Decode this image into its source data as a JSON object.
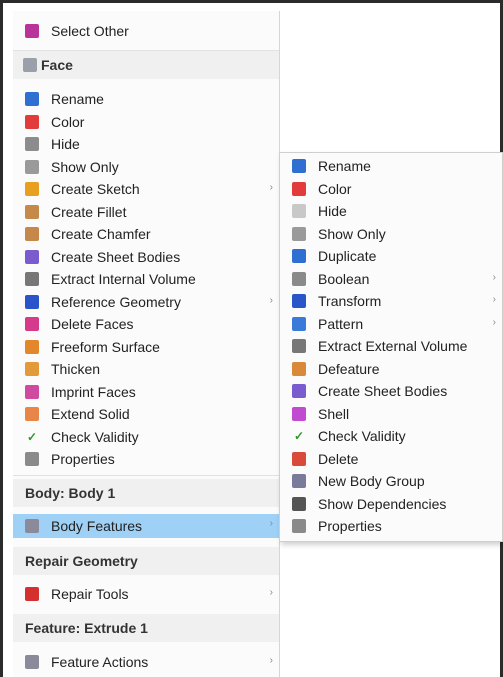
{
  "main_menu": {
    "top_item": {
      "label": "Select Other",
      "icon": "select-other-icon",
      "color": "#b8339a"
    },
    "face_header": {
      "label": "Face",
      "icon": "face-icon"
    },
    "face_items": [
      {
        "label": "Rename",
        "icon": "rename-icon",
        "color": "#2f6fd1"
      },
      {
        "label": "Color",
        "icon": "color-wheel-icon",
        "color": "#e23b3b"
      },
      {
        "label": "Hide",
        "icon": "hide-icon",
        "color": "#8c8c8c"
      },
      {
        "label": "Show Only",
        "icon": "show-only-icon",
        "color": "#9a9a9a"
      },
      {
        "label": "Create Sketch",
        "icon": "sketch-pencil-icon",
        "color": "#e8a020",
        "submenu": true
      },
      {
        "label": "Create Fillet",
        "icon": "fillet-icon",
        "color": "#c58a4a"
      },
      {
        "label": "Create Chamfer",
        "icon": "chamfer-icon",
        "color": "#c5874a"
      },
      {
        "label": "Create Sheet Bodies",
        "icon": "sheet-bodies-icon",
        "color": "#7a5ccf"
      },
      {
        "label": "Extract Internal Volume",
        "icon": "extract-volume-icon",
        "color": "#777777"
      },
      {
        "label": "Reference Geometry",
        "icon": "reference-geometry-icon",
        "color": "#2a55c8",
        "submenu": true
      },
      {
        "label": "Delete Faces",
        "icon": "delete-faces-icon",
        "color": "#d63a8a"
      },
      {
        "label": "Freeform Surface",
        "icon": "freeform-surface-icon",
        "color": "#e3882a"
      },
      {
        "label": "Thicken",
        "icon": "thicken-icon",
        "color": "#e39a3a"
      },
      {
        "label": "Imprint Faces",
        "icon": "imprint-faces-icon",
        "color": "#d04aa0"
      },
      {
        "label": "Extend Solid",
        "icon": "extend-solid-icon",
        "color": "#e8864a"
      },
      {
        "label": "Check Validity",
        "icon": "check-icon",
        "color": "#2a9a2a"
      },
      {
        "label": "Properties",
        "icon": "properties-gear-icon",
        "color": "#8a8a8a"
      }
    ],
    "body_header": {
      "label": "Body: Body 1"
    },
    "body_item": {
      "label": "Body Features",
      "icon": "body-features-icon",
      "color": "#8a8a9a",
      "submenu": true
    },
    "repair_header": {
      "label": "Repair Geometry"
    },
    "repair_item": {
      "label": "Repair Tools",
      "icon": "repair-tools-icon",
      "color": "#d43030",
      "submenu": true
    },
    "feature_header": {
      "label": "Feature: Extrude 1"
    },
    "feature_item": {
      "label": "Feature Actions",
      "icon": "feature-actions-icon",
      "color": "#8a8a9a",
      "submenu": true
    }
  },
  "sub_menu": {
    "items": [
      {
        "label": "Rename",
        "icon": "rename-icon",
        "color": "#2f6fd1"
      },
      {
        "label": "Color",
        "icon": "color-wheel-icon",
        "color": "#e23b3b"
      },
      {
        "label": "Hide",
        "icon": "hide-icon",
        "color": "#c8c8c8"
      },
      {
        "label": "Show Only",
        "icon": "show-only-icon",
        "color": "#9a9a9a"
      },
      {
        "label": "Duplicate",
        "icon": "duplicate-icon",
        "color": "#2f6fd1"
      },
      {
        "label": "Boolean",
        "icon": "boolean-icon",
        "color": "#8a8a8a",
        "submenu": true
      },
      {
        "label": "Transform",
        "icon": "transform-icon",
        "color": "#2a55c8",
        "submenu": true
      },
      {
        "label": "Pattern",
        "icon": "pattern-icon",
        "color": "#3a7ad8",
        "submenu": true
      },
      {
        "label": "Extract External Volume",
        "icon": "extract-volume-icon",
        "color": "#777777"
      },
      {
        "label": "Defeature",
        "icon": "defeature-icon",
        "color": "#d8893a"
      },
      {
        "label": "Create Sheet Bodies",
        "icon": "sheet-bodies-icon",
        "color": "#7a5ccf"
      },
      {
        "label": "Shell",
        "icon": "shell-icon",
        "color": "#c04ad0"
      },
      {
        "label": "Check Validity",
        "icon": "check-icon",
        "color": "#2a9a2a"
      },
      {
        "label": "Delete",
        "icon": "delete-icon",
        "color": "#d84a3a"
      },
      {
        "label": "New Body Group",
        "icon": "body-group-icon",
        "color": "#7a7a9a"
      },
      {
        "label": "Show Dependencies",
        "icon": "dependencies-icon",
        "color": "#555555"
      },
      {
        "label": "Properties",
        "icon": "properties-gear-icon",
        "color": "#8a8a8a"
      }
    ]
  },
  "submenu_arrow": "›",
  "check_glyph": "✓"
}
